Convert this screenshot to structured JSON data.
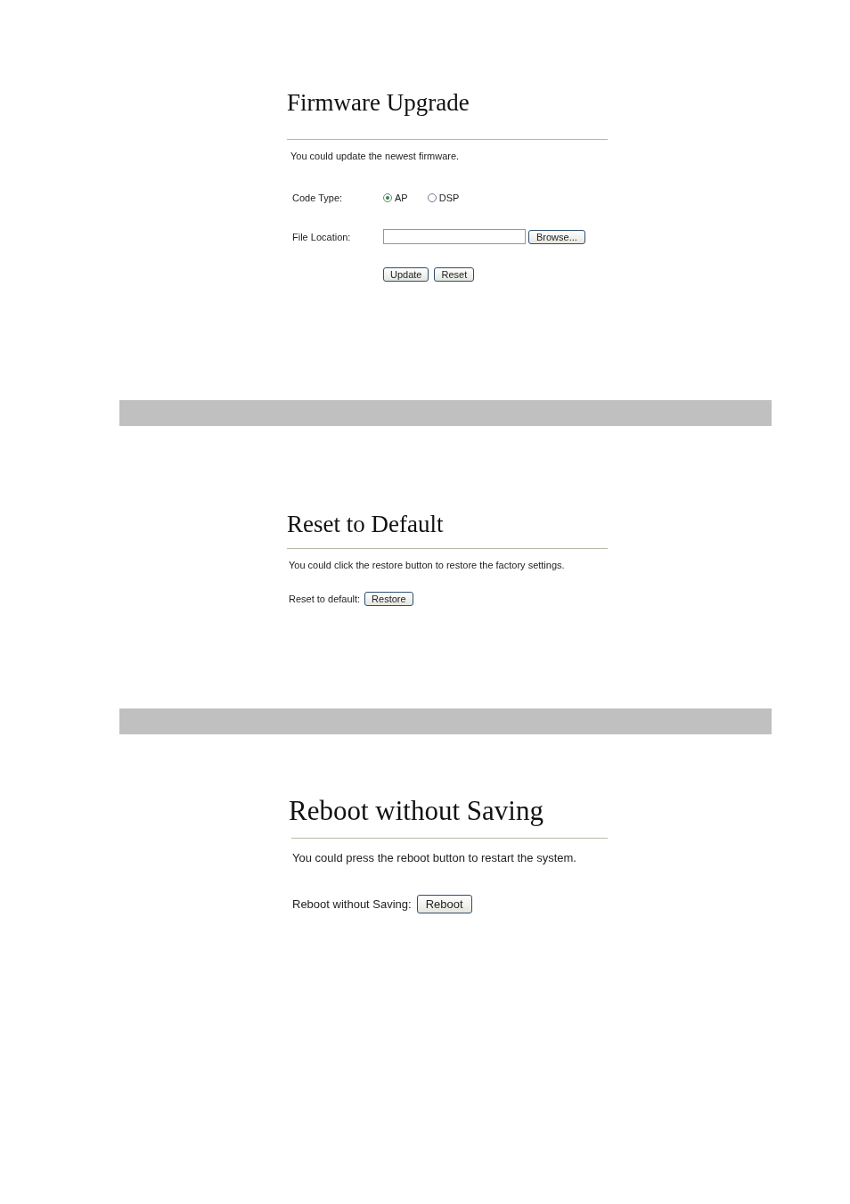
{
  "firmware_upgrade": {
    "title": "Firmware Upgrade",
    "description": "You could update the newest firmware.",
    "code_type": {
      "label": "Code Type:",
      "options": [
        {
          "label": "AP",
          "selected": true
        },
        {
          "label": "DSP",
          "selected": false
        }
      ]
    },
    "file_location": {
      "label": "File Location:",
      "browse_button": "Browse..."
    },
    "buttons": [
      "Update",
      "Reset"
    ]
  },
  "reset_to_default": {
    "title": "Reset to Default",
    "description": "You could click the restore button to restore the factory settings.",
    "label": "Reset to default:",
    "button": "Restore"
  },
  "reboot": {
    "title": "Reboot without Saving",
    "description": "You could press the reboot button to restart the system.",
    "label": "Reboot without Saving:",
    "button": "Reboot"
  }
}
